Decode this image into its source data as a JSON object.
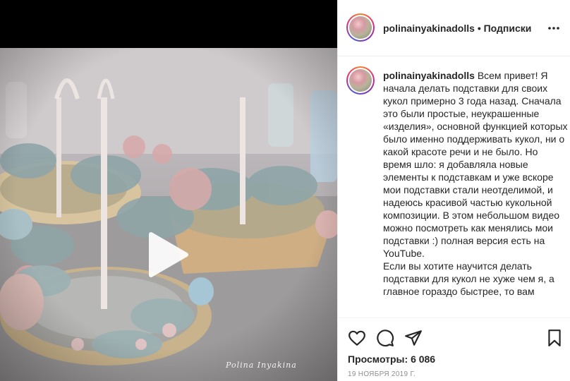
{
  "post": {
    "username": "polinainyakinadolls",
    "separator": "•",
    "follow_label": "Подписки",
    "caption": "Всем привет! Я начала делать подставки для своих кукол примерно 3 года назад. Сначала это были простые, неукрашенные «изделия», основной функцией которых было именно поддерживать кукол, ни о какой красоте речи и не было. Но время шло: я добавляла новые элементы к подставкам и уже вскоре мои подставки стали неотделимой, и надеюсь красивой частью кукольной композиции. В этом небольшом видео можно посмотреть как менялись мои подставки :) полная версия есть на YouTube.\nЕсли вы хотите научится делать подставки для кукол не хуже чем я, а главное гораздо быстрее, то вам",
    "views_label": "Просмотры:",
    "views_count": "6 086",
    "date": "19 НОЯБРЯ 2019 Г."
  },
  "media": {
    "watermark": "Polina Inyakina",
    "play_icon": "play-icon"
  },
  "icons": {
    "more": "more-options-icon",
    "like": "heart-icon",
    "comment": "comment-icon",
    "share": "share-icon",
    "save": "bookmark-icon"
  },
  "colors": {
    "text": "#262626",
    "muted": "#8e8e8e",
    "border": "#efefef"
  }
}
